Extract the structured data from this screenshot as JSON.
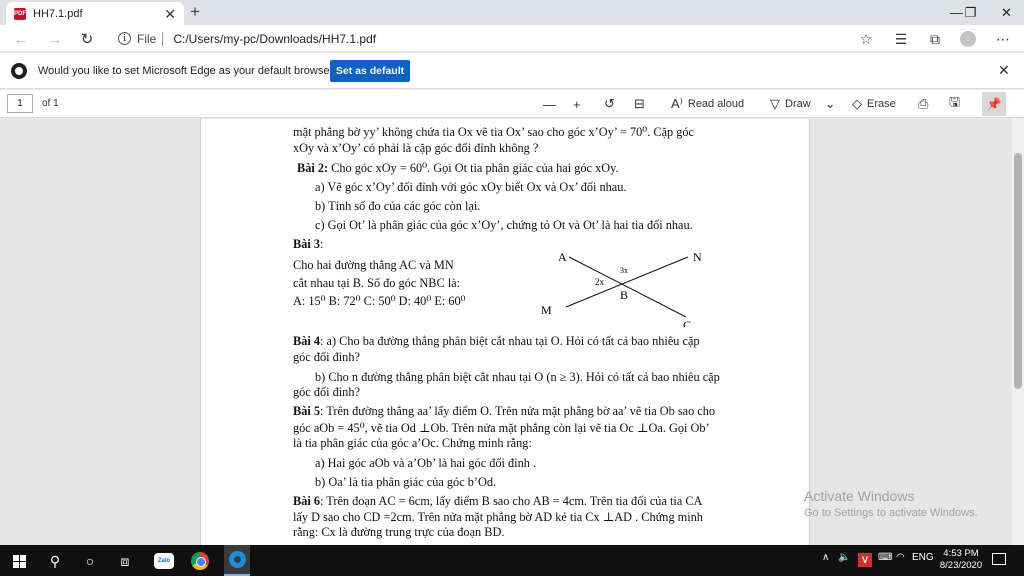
{
  "tab": {
    "title": "HH7.1.pdf",
    "close": "✕",
    "new_tab": "+"
  },
  "window_controls": {
    "minimize": "—",
    "restore": "❐",
    "close": "✕"
  },
  "address": {
    "scheme": "File",
    "url": "C:/Users/my-pc/Downloads/HH7.1.pdf"
  },
  "infobar": {
    "message": "Would you like to set Microsoft Edge as your default browser?",
    "button": "Set as default"
  },
  "pdf_toolbar": {
    "page_number": "1",
    "page_total": "of 1",
    "read_aloud": "Read aloud",
    "draw": "Draw",
    "erase": "Erase"
  },
  "document": {
    "lines": [
      "mặt phẳng bờ yy’ không chứa tia Ox vẽ tia Ox’ sao cho góc x’Oy’ = 70⁰. Cặp góc",
      "xOy và x’Oy’ có phải là cặp góc đối đỉnh không ?",
      "Cho góc xOy = 60⁰. Gọi Ot tia phân giác của hai góc xOy.",
      "a) Vẽ góc x’Oy’ đối đỉnh với góc xOy biết Ox và Ox’ đối nhau.",
      "b) Tính số đo của các góc còn lại.",
      "c) Gọi Ot’ là phân giác của góc x’Oy’, chứng tỏ  Ot và Ot’ là hai tia đối nhau.",
      "Cho hai đường thẳng AC và MN",
      "cắt nhau tại B. Số đo góc NBC là:",
      "A: 15⁰  B: 72⁰  C: 50⁰  D: 40⁰  E: 60⁰",
      "a) Cho ba đường thẳng phân biệt cắt nhau tại O. Hỏi có tất cả bao nhiêu cặp",
      "góc đối đỉnh?",
      "b) Cho n đường thẳng phân biệt cắt nhau tại O (n ≥ 3). Hỏi có tất cả bao nhiêu cặp",
      "góc đối đỉnh?",
      "Trên đường thẳng aa’ lấy điểm O. Trên nửa mặt phẳng bờ aa’ vẽ tia Ob sao cho",
      "góc aOb = 45⁰, vẽ tia Od ⊥Ob. Trên nửa mặt phẳng còn lại vẽ tia Oc ⊥Oa. Gọi Ob’",
      "là tia phân giác của góc a’Oc. Chứng minh rằng:",
      "a) Hai góc aOb và a’Ob’ là hai góc đối đỉnh .",
      "b) Oa’ là tia phân giác của góc b’Od.",
      "Trên đoạn AC = 6cm, lấy điểm B sao cho AB = 4cm. Trên tia đối của tia CA",
      "lấy D sao cho CD =2cm. Trên nửa mặt phẳng bờ AD kẻ tia Cx ⊥AD . Chứng minh",
      "rằng: Cx là đường trung trực của đoạn BD."
    ],
    "headings": {
      "bai2": "Bài 2:",
      "bai3": "Bài 3",
      "bai3_colon": ":",
      "bai4": "Bài 4",
      "bai5": "Bài 5",
      "bai6": "Bài 6"
    },
    "diagram_labels": {
      "A": "A",
      "N": "N",
      "M": "M",
      "C": "C",
      "B": "B",
      "x2": "2x",
      "x3": "3x"
    }
  },
  "watermark": {
    "line1": "Activate Windows",
    "line2": "Go to Settings to activate Windows."
  },
  "taskbar": {
    "zalo": "Zalo",
    "lang": "ENG",
    "time": "4:53 PM",
    "date": "8/23/2020"
  }
}
